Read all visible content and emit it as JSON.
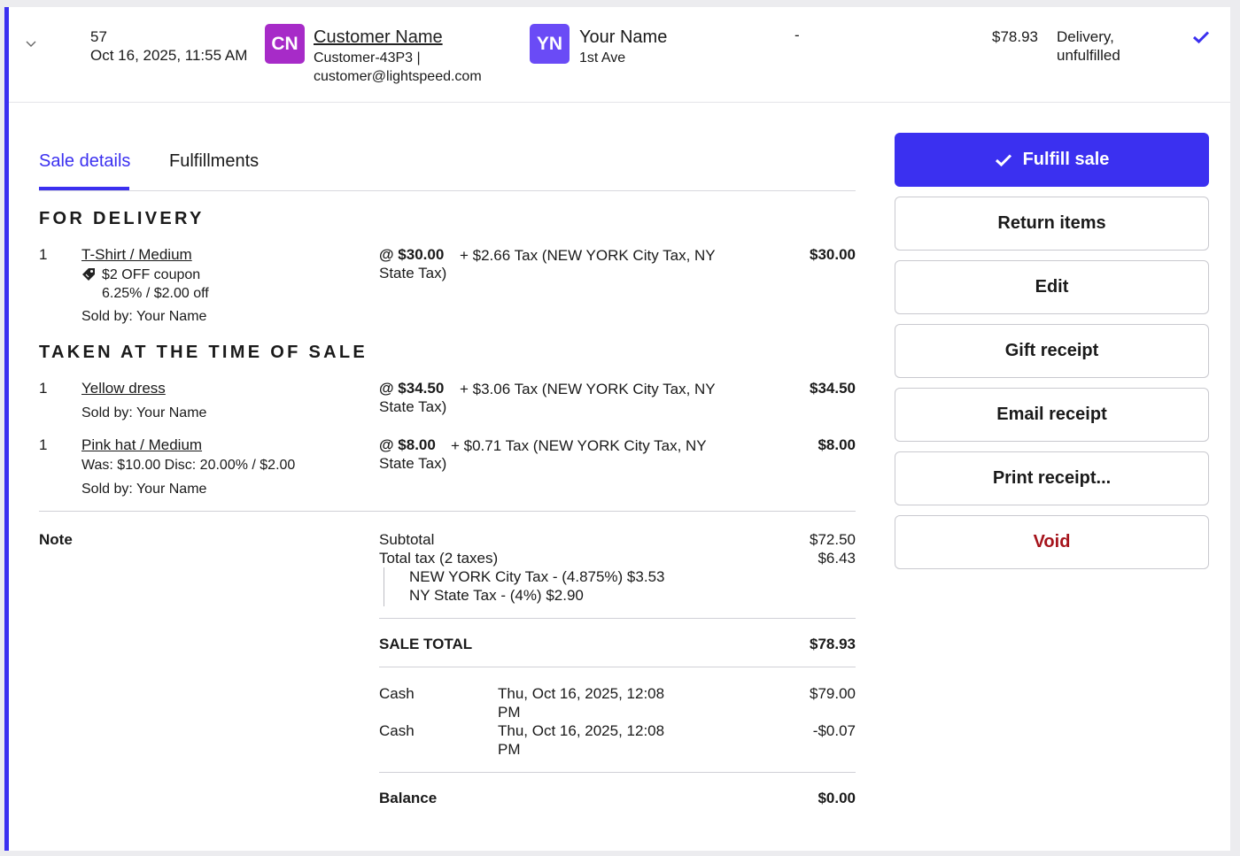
{
  "header": {
    "sale_number": "57",
    "sale_date": "Oct 16, 2025, 11:55 AM",
    "customer": {
      "initials": "CN",
      "initials_color": "#a72bc8",
      "name": "Customer Name",
      "code_line": "Customer-43P3 |",
      "email": "customer@lightspeed.com"
    },
    "employee": {
      "initials": "YN",
      "initials_color": "#6a4bf6",
      "name": "Your Name",
      "location": "1st Ave"
    },
    "note_value": "-",
    "total": "$78.93",
    "status_line1": "Delivery,",
    "status_line2": "unfulfilled",
    "status_icon": "check-icon"
  },
  "tabs": {
    "sale_details": "Sale details",
    "fulfillments": "Fulfillments",
    "active": "sale_details"
  },
  "sections": {
    "delivery_title": "FOR DELIVERY",
    "taken_title": "TAKEN AT THE TIME OF SALE"
  },
  "items": [
    {
      "qty": "1",
      "name": "T-Shirt / Medium",
      "coupon_label": "$2 OFF coupon",
      "coupon_detail": "6.25% / $2.00 off",
      "sold_by": "Sold by: Your Name",
      "unit_price": "@ $30.00",
      "tax_line1": "+ $2.66 Tax (NEW YORK City Tax, NY",
      "tax_line2": "State Tax)",
      "amount": "$30.00"
    },
    {
      "qty": "1",
      "name": "Yellow dress",
      "sold_by": "Sold by: Your Name",
      "unit_price": "@ $34.50",
      "tax_line1": "+ $3.06 Tax (NEW YORK City Tax, NY",
      "tax_line2": "State Tax)",
      "amount": "$34.50"
    },
    {
      "qty": "1",
      "name": "Pink hat / Medium",
      "discount": "Was: $10.00 Disc: 20.00% / $2.00",
      "sold_by": "Sold by: Your Name",
      "unit_price": "@ $8.00",
      "tax_line1": "+ $0.71 Tax (NEW YORK City Tax, NY",
      "tax_line2": "State Tax)",
      "amount": "$8.00"
    }
  ],
  "summary": {
    "note_label": "Note",
    "subtotal_label": "Subtotal",
    "subtotal": "$72.50",
    "total_tax_label": "Total tax (2 taxes)",
    "total_tax": "$6.43",
    "tax_breakdown": [
      "NEW YORK City Tax - (4.875%) $3.53",
      "NY State Tax - (4%) $2.90"
    ],
    "sale_total_label": "SALE TOTAL",
    "sale_total": "$78.93",
    "payments": [
      {
        "method": "Cash",
        "date_line1": "Thu, Oct 16, 2025, 12:08",
        "date_line2": "PM",
        "amount": "$79.00"
      },
      {
        "method": "Cash",
        "date_line1": "Thu, Oct 16, 2025, 12:08",
        "date_line2": "PM",
        "amount": "-$0.07"
      }
    ],
    "balance_label": "Balance",
    "balance": "$0.00"
  },
  "actions": {
    "fulfill": "Fulfill sale",
    "return_items": "Return items",
    "edit": "Edit",
    "gift_receipt": "Gift receipt",
    "email_receipt": "Email receipt",
    "print_receipt": "Print receipt...",
    "void": "Void",
    "primary_color": "#3b30f0",
    "void_color": "#a6141c"
  }
}
